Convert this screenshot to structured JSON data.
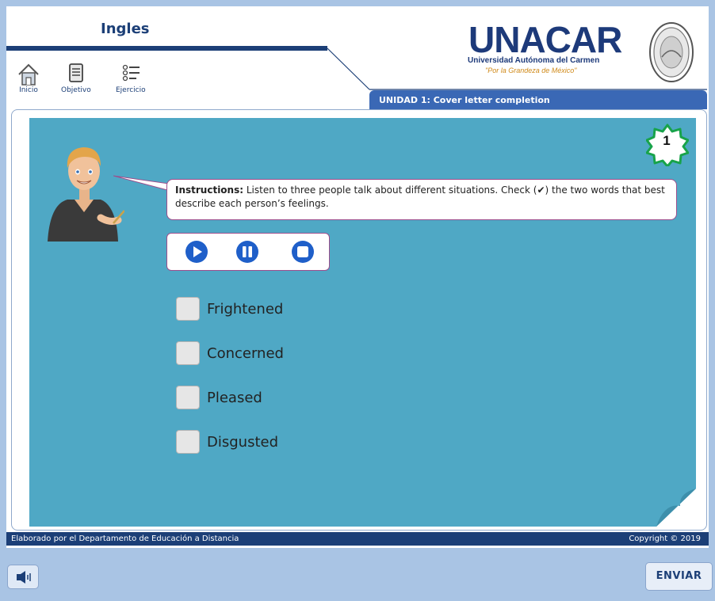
{
  "header": {
    "course_title": "Ingles",
    "nav": [
      {
        "label": "Inicio",
        "icon": "home-icon"
      },
      {
        "label": "Objetivo",
        "icon": "document-icon"
      },
      {
        "label": "Ejercicio",
        "icon": "checklist-icon"
      }
    ],
    "logo": {
      "name": "UNACAR",
      "subtitle": "Universidad Autónoma del Carmen",
      "motto": "\"Por la Grandeza de México\""
    },
    "unit_title": "UNIDAD 1:  Cover letter completion"
  },
  "exercise": {
    "number": "1",
    "instructions_label": "Instructions:",
    "instructions_text": " Listen to three people talk about different situations. Check (✔) the two words that best describe each person’s feelings.",
    "player": [
      {
        "icon": "play-icon"
      },
      {
        "icon": "pause-icon"
      },
      {
        "icon": "stop-icon"
      }
    ],
    "options": [
      "Frightened",
      "Concerned",
      "Pleased",
      "Disgusted"
    ]
  },
  "footer": {
    "credit": "Elaborado por el Departamento de Educación a Distancia",
    "copyright": "Copyright © 2019"
  },
  "controls": {
    "sound_icon": "speaker-icon",
    "send_label": "ENVIAR"
  },
  "colors": {
    "brand": "#1c3f77",
    "unit_bar": "#3a68b5",
    "content_bg": "#4fa8c5",
    "accent": "#9d4e8c",
    "page_bg": "#a9c4e4"
  }
}
